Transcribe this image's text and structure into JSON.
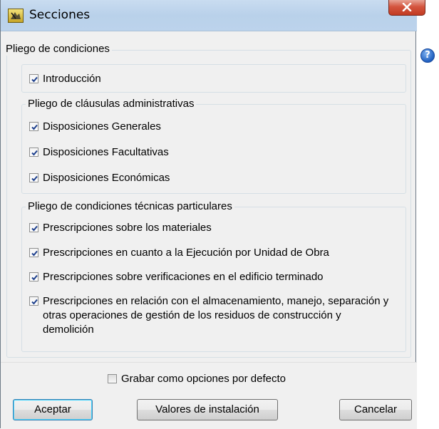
{
  "window": {
    "title": "Secciones"
  },
  "titlebar": {
    "app_icon": "app-icon",
    "close_icon": "close-icon"
  },
  "help": {
    "icon": "help-icon",
    "glyph": "?"
  },
  "main_group": {
    "label": "Pliego de condiciones"
  },
  "intro": {
    "label": "Introducción",
    "checked": true
  },
  "admin_group": {
    "label": "Pliego de cláusulas administrativas",
    "items": [
      {
        "label": "Disposiciones Generales",
        "checked": true
      },
      {
        "label": "Disposiciones Facultativas",
        "checked": true
      },
      {
        "label": "Disposiciones Económicas",
        "checked": true
      }
    ]
  },
  "tech_group": {
    "label": "Pliego de condiciones técnicas particulares",
    "items": [
      {
        "label": "Prescripciones sobre los materiales",
        "checked": true
      },
      {
        "label": "Prescripciones en cuanto a la Ejecución por Unidad de Obra",
        "checked": true
      },
      {
        "label": "Prescripciones sobre verificaciones en el edificio terminado",
        "checked": true
      },
      {
        "label": "Prescripciones en relación con el almacenamiento, manejo, separación y otras operaciones de gestión de los residuos de construcción y demolición",
        "checked": true
      }
    ]
  },
  "save_defaults": {
    "label": "Grabar como opciones por defecto",
    "checked": false
  },
  "buttons": {
    "accept": "Aceptar",
    "install_values": "Valores de instalación",
    "cancel": "Cancelar"
  },
  "colors": {
    "check": "#1d3f8c",
    "close": "#c23b22",
    "help": "#1f5fc0"
  }
}
